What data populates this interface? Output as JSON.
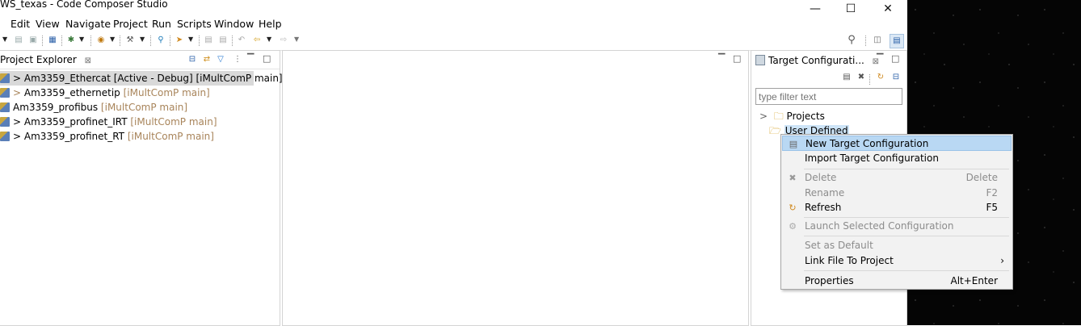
{
  "window": {
    "title": "WS_texas - Code Composer Studio",
    "minimize_icon": "minimize-icon",
    "maximize_icon": "maximize-icon",
    "close_icon": "close-icon"
  },
  "menubar": {
    "items": [
      "Edit",
      "View",
      "Navigate",
      "Project",
      "Run",
      "Scripts",
      "Window",
      "Help"
    ]
  },
  "toolbar": {
    "search_icon": "search-icon",
    "perspective_icons": [
      "open-perspective-icon",
      "ccs-edit-perspective-icon"
    ]
  },
  "project_explorer": {
    "tab_label": "Project Explorer",
    "close_glyph": "⊠",
    "items": [
      {
        "expander": ">",
        "name": "Am3359_Ethercat",
        "suffix": "  [Active - Debug] [iMultComP main]",
        "selected": true
      },
      {
        "expander": ">",
        "name": "Am3359_ethernetip",
        "suffix": " [iMultComP main]",
        "selected": false
      },
      {
        "expander": "",
        "name": "Am3359_profibus",
        "suffix": " [iMultComP main]",
        "selected": false
      },
      {
        "expander": ">",
        "name": "Am3359_profinet_IRT",
        "suffix": " [iMultComP main]",
        "selected": false
      },
      {
        "expander": ">",
        "name": "Am3359_profinet_RT",
        "suffix": " [iMultComP main]",
        "selected": false
      }
    ]
  },
  "target_config": {
    "tab_label": "Target Configurati...",
    "close_glyph": "⊠",
    "filter_placeholder": "type filter text",
    "tree": [
      {
        "expander": ">",
        "label": "Projects"
      },
      {
        "expander": "",
        "label": "User Defined"
      }
    ]
  },
  "context_menu": {
    "items": [
      {
        "label": "New Target Configuration",
        "accel": "",
        "icon": "new-target-config-icon",
        "disabled": false,
        "selected": true
      },
      {
        "label": "Import Target Configuration",
        "accel": "",
        "icon": "",
        "disabled": false,
        "selected": false
      },
      {
        "label": "Delete",
        "accel": "Delete",
        "icon": "delete-icon",
        "disabled": true,
        "selected": false
      },
      {
        "label": "Rename",
        "accel": "F2",
        "icon": "",
        "disabled": true,
        "selected": false
      },
      {
        "label": "Refresh",
        "accel": "F5",
        "icon": "refresh-icon",
        "disabled": false,
        "selected": false
      },
      {
        "label": "Launch Selected Configuration",
        "accel": "",
        "icon": "launch-icon",
        "disabled": true,
        "selected": false
      },
      {
        "label": "Set as Default",
        "accel": "",
        "icon": "",
        "disabled": true,
        "selected": false
      },
      {
        "label": "Link File To Project",
        "accel": "›",
        "icon": "",
        "disabled": false,
        "selected": false
      },
      {
        "label": "Properties",
        "accel": "Alt+Enter",
        "icon": "",
        "disabled": false,
        "selected": false
      }
    ]
  }
}
